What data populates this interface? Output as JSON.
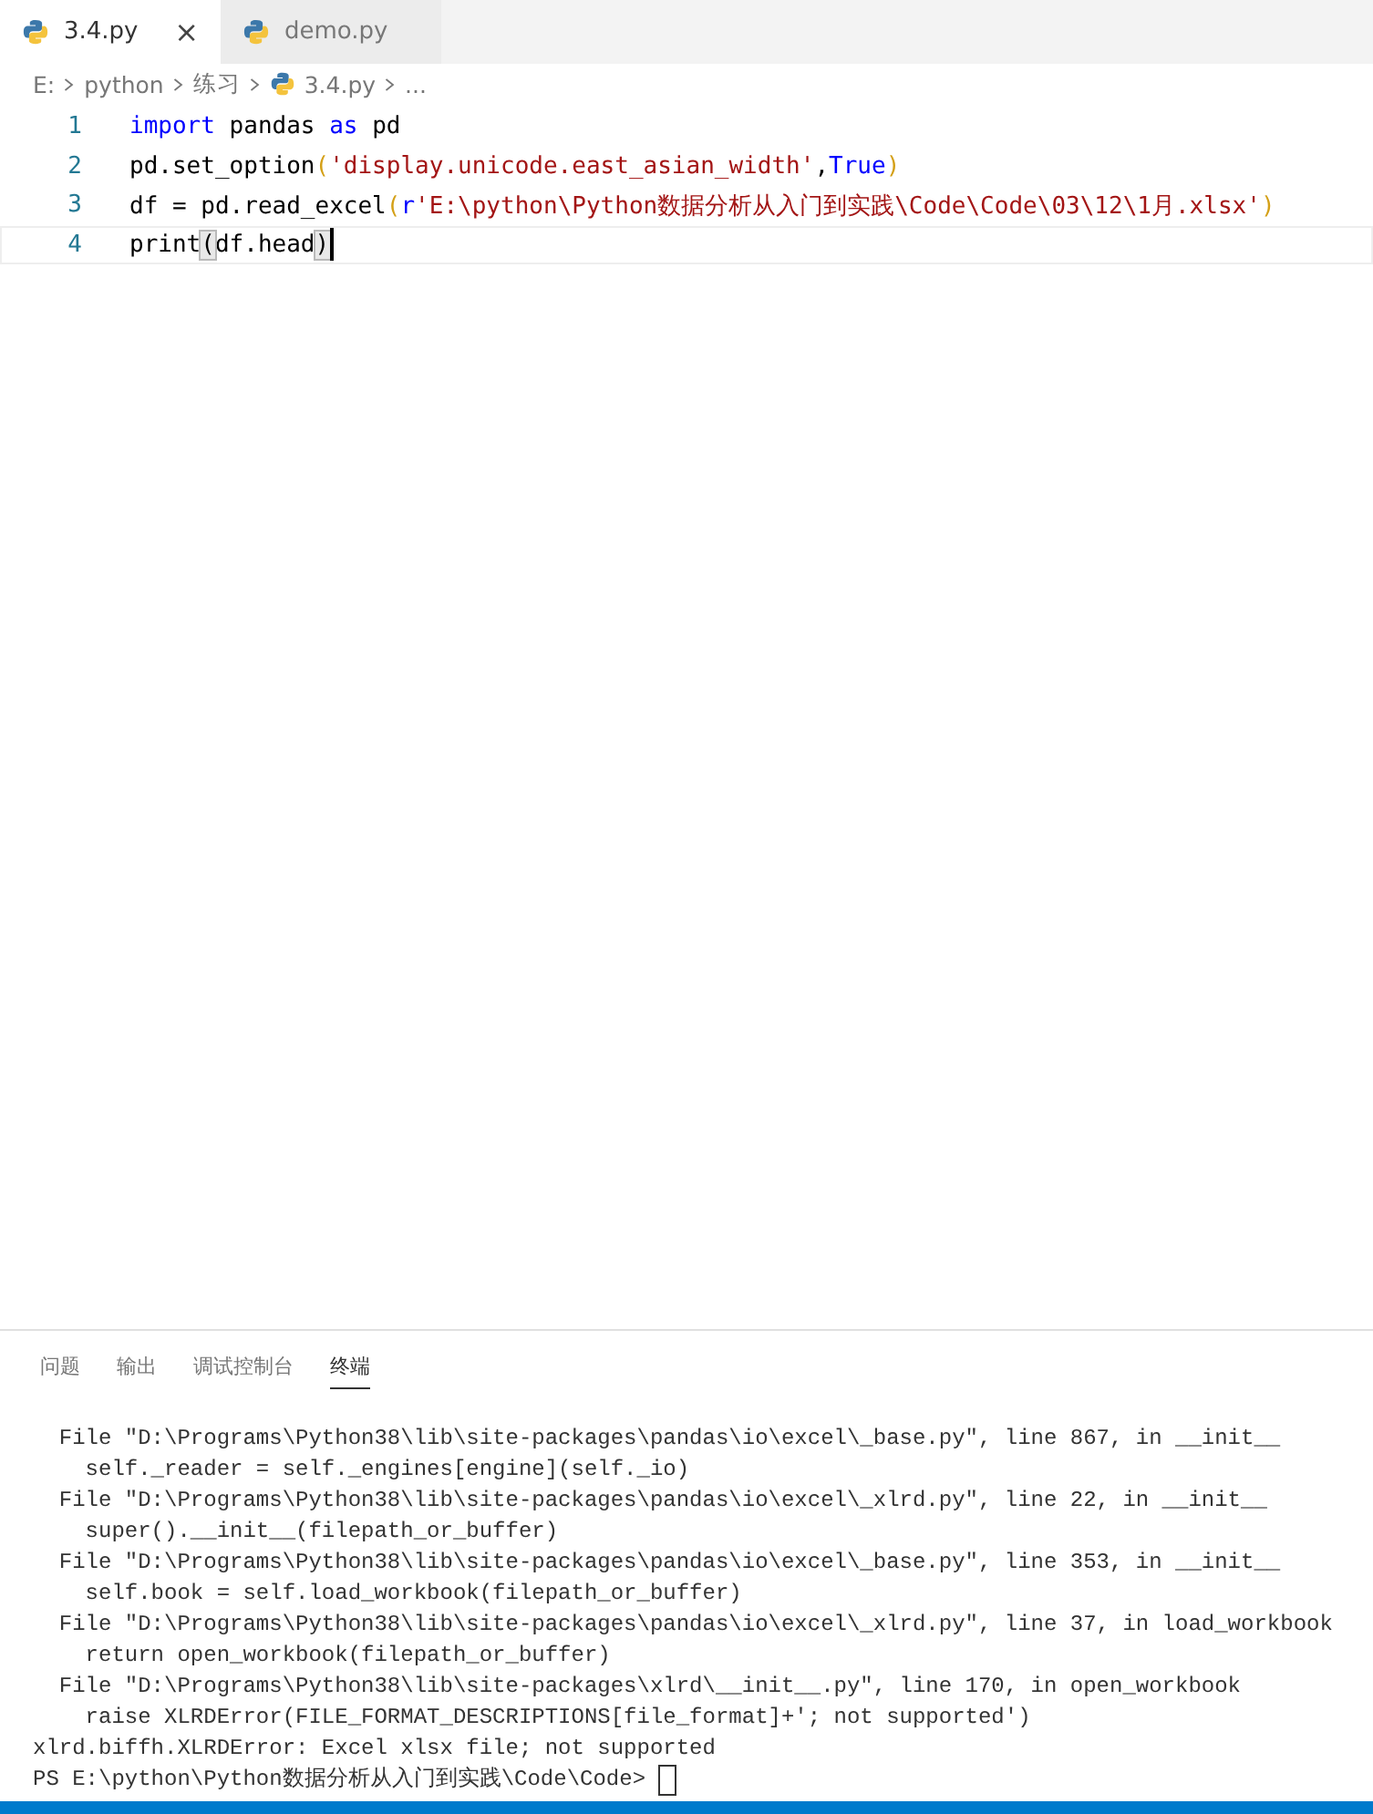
{
  "tabs": [
    {
      "label": "3.4.py",
      "selected": true,
      "close": "×"
    },
    {
      "label": "demo.py",
      "selected": false
    }
  ],
  "breadcrumb": [
    "E:",
    "python",
    "练习",
    "3.4.py",
    "..."
  ],
  "editor": {
    "lines": [
      {
        "number": "1",
        "current": false,
        "tokens": [
          {
            "kind": "keyword",
            "text": "import"
          },
          {
            "kind": "plain",
            "text": " pandas "
          },
          {
            "kind": "keyword",
            "text": "as"
          },
          {
            "kind": "plain",
            "text": " pd"
          }
        ]
      },
      {
        "number": "2",
        "current": false,
        "tokens": [
          {
            "kind": "plain",
            "text": "pd.set_option"
          },
          {
            "kind": "bracket",
            "text": "("
          },
          {
            "kind": "string",
            "text": "'display.unicode.east_asian_width'"
          },
          {
            "kind": "plain",
            "text": ","
          },
          {
            "kind": "keyword",
            "text": "True"
          },
          {
            "kind": "bracket",
            "text": ")"
          }
        ]
      },
      {
        "number": "3",
        "current": false,
        "tokens": [
          {
            "kind": "plain",
            "text": "df = pd.read_excel"
          },
          {
            "kind": "bracket",
            "text": "("
          },
          {
            "kind": "keyword",
            "text": "r"
          },
          {
            "kind": "string",
            "text": "'E:\\python\\Python数据分析从入门到实践\\Code\\Code\\03\\12\\1月.xlsx'"
          },
          {
            "kind": "bracket",
            "text": ")"
          }
        ]
      },
      {
        "number": "4",
        "current": true,
        "tokens": [
          {
            "kind": "plain",
            "text": "print"
          },
          {
            "kind": "matched",
            "text": "("
          },
          {
            "kind": "plain",
            "text": "df.head"
          },
          {
            "kind": "matched",
            "text": ")"
          }
        ]
      }
    ]
  },
  "panel": {
    "tabs": [
      {
        "label": "问题",
        "selected": false
      },
      {
        "label": "输出",
        "selected": false
      },
      {
        "label": "调试控制台",
        "selected": false
      },
      {
        "label": "终端",
        "selected": true
      }
    ],
    "terminal": [
      "  File \"D:\\Programs\\Python38\\lib\\site-packages\\pandas\\io\\excel\\_base.py\", line 867, in __init__",
      "    self._reader = self._engines[engine](self._io)",
      "  File \"D:\\Programs\\Python38\\lib\\site-packages\\pandas\\io\\excel\\_xlrd.py\", line 22, in __init__",
      "    super().__init__(filepath_or_buffer)",
      "  File \"D:\\Programs\\Python38\\lib\\site-packages\\pandas\\io\\excel\\_base.py\", line 353, in __init__",
      "    self.book = self.load_workbook(filepath_or_buffer)",
      "  File \"D:\\Programs\\Python38\\lib\\site-packages\\pandas\\io\\excel\\_xlrd.py\", line 37, in load_workbook",
      "    return open_workbook(filepath_or_buffer)",
      "  File \"D:\\Programs\\Python38\\lib\\site-packages\\xlrd\\__init__.py\", line 170, in open_workbook",
      "    raise XLRDError(FILE_FORMAT_DESCRIPTIONS[file_format]+'; not supported')",
      "xlrd.biffh.XLRDError: Excel xlsx file; not supported"
    ],
    "prompt": "PS E:\\python\\Python数据分析从入门到实践\\Code\\Code>"
  }
}
